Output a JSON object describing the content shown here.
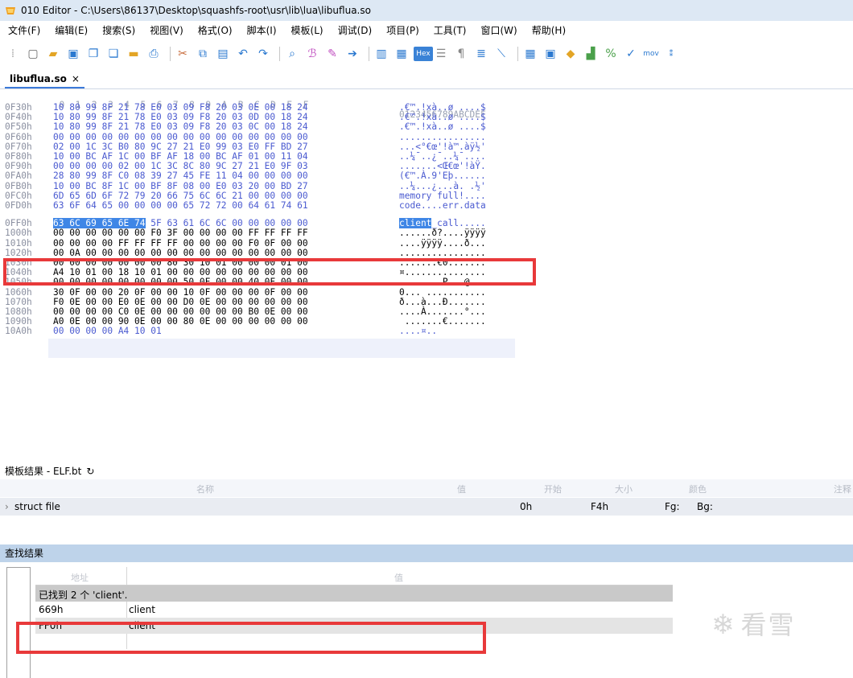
{
  "window": {
    "title": "010 Editor - C:\\Users\\86137\\Desktop\\squashfs-root\\usr\\lib\\lua\\libuflua.so"
  },
  "menu": [
    "文件(F)",
    "编辑(E)",
    "搜索(S)",
    "视图(V)",
    "格式(O)",
    "脚本(I)",
    "模板(L)",
    "调试(D)",
    "项目(P)",
    "工具(T)",
    "窗口(W)",
    "帮助(H)"
  ],
  "toolbar": {
    "hex_label": "Hex",
    "mov_label": "mov"
  },
  "tab": {
    "label": "libuflua.so",
    "close": "×"
  },
  "hex": {
    "column_header": "  0  1  2  3  4  5  6  7  8  9  A  B  C  D  E  F",
    "ascii_header": "0123456789ABCDEF",
    "rows": [
      {
        "addr": "0F30h",
        "hex": "10 80 99 8F 21 78 E0 03 09 F8 20 03 0E 00 18 24",
        "ascii": ".€™.!xà..ø ....$"
      },
      {
        "addr": "0F40h",
        "hex": "10 80 99 8F 21 78 E0 03 09 F8 20 03 0D 00 18 24",
        "ascii": ".€™.!xà..ø ....$"
      },
      {
        "addr": "0F50h",
        "hex": "10 80 99 8F 21 78 E0 03 09 F8 20 03 0C 00 18 24",
        "ascii": ".€™.!xà..ø ....$"
      },
      {
        "addr": "0F60h",
        "hex": "00 00 00 00 00 00 00 00 00 00 00 00 00 00 00 00",
        "ascii": "................"
      },
      {
        "addr": "0F70h",
        "hex": "02 00 1C 3C B0 80 9C 27 21 E0 99 03 E0 FF BD 27",
        "ascii": "...<°€œ'!à™.àÿ½'"
      },
      {
        "addr": "0F80h",
        "hex": "10 00 BC AF 1C 00 BF AF 18 00 BC AF 01 00 11 04",
        "ascii": "..¼¯..¿¯..¼¯...."
      },
      {
        "addr": "0F90h",
        "hex": "00 00 00 00 02 00 1C 3C 8C 80 9C 27 21 E0 9F 03",
        "ascii": ".......<Œ€œ'!àŸ."
      },
      {
        "addr": "0FA0h",
        "hex": "28 80 99 8F C0 08 39 27 45 FE 11 04 00 00 00 00",
        "ascii": "(€™.À.9'Eþ......"
      },
      {
        "addr": "0FB0h",
        "hex": "10 00 BC 8F 1C 00 BF 8F 08 00 E0 03 20 00 BD 27",
        "ascii": "..¼...¿...à. .½'"
      },
      {
        "addr": "0FC0h",
        "hex": "6D 65 6D 6F 72 79 20 66 75 6C 6C 21 00 00 00 00",
        "ascii": "memory full!...."
      },
      {
        "addr": "0FD0h",
        "hex": "63 6F 64 65 00 00 00 00 65 72 72 00 64 61 74 61",
        "ascii": "code....err.data"
      },
      {
        "addr": "0FF0h",
        "hex": "63 6C 69 65 6E 74 5F 63 61 6C 6C 00 00 00 00 00",
        "ascii": "client_call....."
      },
      {
        "addr": "1000h",
        "hex": "00 00 00 00 00 00 F0 3F 00 00 00 00 FF FF FF FF",
        "ascii": "......ð?....ÿÿÿÿ"
      },
      {
        "addr": "1010h",
        "hex": "00 00 00 00 FF FF FF FF 00 00 00 00 F0 0F 00 00",
        "ascii": "....ÿÿÿÿ....ð..."
      },
      {
        "addr": "1020h",
        "hex": "00 0A 00 00 00 00 00 00 00 00 00 00 00 00 00 00",
        "ascii": "................"
      },
      {
        "addr": "1030h",
        "hex": "00 00 00 00 00 00 00 80 30 10 01 00 00 00 01 00",
        "ascii": ".......€0......."
      },
      {
        "addr": "1040h",
        "hex": "A4 10 01 00 18 10 01 00 00 00 00 00 00 00 00 00",
        "ascii": "¤..............."
      },
      {
        "addr": "1050h",
        "hex": "00 00 00 00 00 00 00 00 50 0F 00 00 40 0F 00 00",
        "ascii": "........P...@..."
      },
      {
        "addr": "1060h",
        "hex": "30 0F 00 00 20 0F 00 00 10 0F 00 00 00 0F 00 00",
        "ascii": "0... ..........."
      },
      {
        "addr": "1070h",
        "hex": "F0 0E 00 00 E0 0E 00 00 D0 0E 00 00 00 00 00 00",
        "ascii": "ð...à...Ð......."
      },
      {
        "addr": "1080h",
        "hex": "00 00 00 00 C0 0E 00 00 00 00 00 00 B0 0E 00 00",
        "ascii": "....À.......°..."
      },
      {
        "addr": "1090h",
        "hex": "A0 0E 00 00 90 0E 00 00 80 0E 00 00 00 00 00 00",
        "ascii": " .......€......."
      },
      {
        "addr": "10A0h",
        "hex": "00 00 00 00 A4 10 01",
        "ascii": "....¤.."
      }
    ]
  },
  "template": {
    "title": "模板结果 - ELF.bt",
    "columns": {
      "name": "名称",
      "value": "值",
      "start": "开始",
      "size": "大小",
      "color": "颜色",
      "comment": "注释"
    },
    "row": {
      "name": "struct file",
      "start": "0h",
      "size": "F4h",
      "fg": "Fg:",
      "bg": "Bg:"
    }
  },
  "find": {
    "title": "查找结果",
    "columns": {
      "address": "地址",
      "value": "值"
    },
    "summary": "已找到 2 个 'client'.",
    "results": [
      {
        "address": "669h",
        "value": "client"
      },
      {
        "address": "FF0h",
        "value": "client"
      }
    ]
  },
  "watermark": {
    "text": "看雪"
  },
  "colors": {
    "highlight": "#3f86e6",
    "red_box": "#e8393a",
    "title_bar": "#dde8f4",
    "find_header": "#bed3ea"
  }
}
